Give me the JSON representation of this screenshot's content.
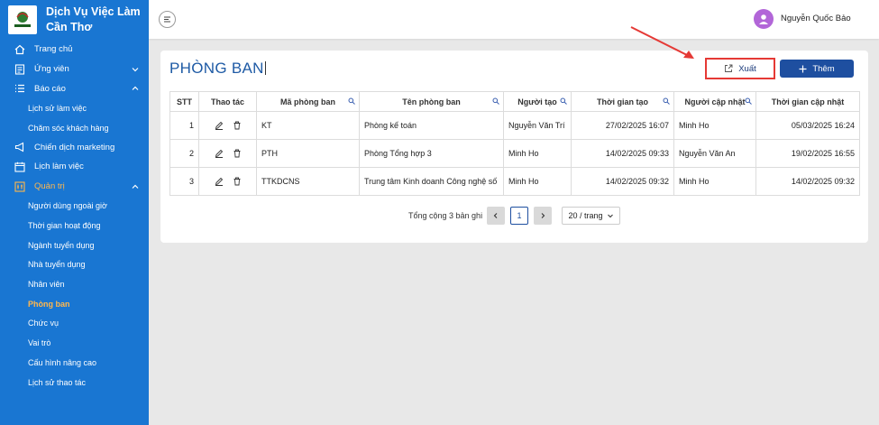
{
  "app": {
    "title": "Dịch Vụ Việc Làm Cần Thơ"
  },
  "sidebar": {
    "items": [
      {
        "label": "Trang chủ",
        "icon": "home-icon"
      },
      {
        "label": "Ứng viên",
        "icon": "candidate-icon"
      },
      {
        "label": "Báo cáo",
        "icon": "list-icon"
      },
      {
        "label": "Lịch sử làm việc"
      },
      {
        "label": "Chăm sóc khách hàng"
      },
      {
        "label": "Chiến dịch marketing",
        "icon": "megaphone-icon"
      },
      {
        "label": "Lịch làm việc",
        "icon": "calendar-icon"
      },
      {
        "label": "Quản trị",
        "icon": "admin-icon"
      },
      {
        "label": "Người dùng ngoài giờ"
      },
      {
        "label": "Thời gian hoạt động"
      },
      {
        "label": "Ngành tuyển dụng"
      },
      {
        "label": "Nhà tuyển dụng"
      },
      {
        "label": "Nhân viên"
      },
      {
        "label": "Phòng ban"
      },
      {
        "label": "Chức vụ"
      },
      {
        "label": "Vai trò"
      },
      {
        "label": "Cấu hình nâng cao"
      },
      {
        "label": "Lịch sử thao tác"
      }
    ]
  },
  "header": {
    "user_name": "Nguyễn Quốc Bảo"
  },
  "main": {
    "title": "PHÒNG BAN",
    "export_label": "Xuất",
    "add_label": "Thêm",
    "columns": [
      "STT",
      "Thao tác",
      "Mã phòng ban",
      "Tên phòng ban",
      "Người tạo",
      "Thời gian tạo",
      "Người cập nhật",
      "Thời gian cập nhật"
    ],
    "rows": [
      {
        "stt": "1",
        "code": "KT",
        "name": "Phòng kế toán",
        "creator": "Nguyễn Văn Trí",
        "created": "27/02/2025 16:07",
        "updater": "Minh Ho",
        "updated": "05/03/2025 16:24"
      },
      {
        "stt": "2",
        "code": "PTH",
        "name": "Phòng Tổng hợp 3",
        "creator": "Minh Ho",
        "created": "14/02/2025 09:33",
        "updater": "Nguyễn Văn An",
        "updated": "19/02/2025 16:55"
      },
      {
        "stt": "3",
        "code": "TTKDCNS",
        "name": "Trung tâm Kinh doanh Công nghệ số",
        "creator": "Minh Ho",
        "created": "14/02/2025 09:32",
        "updater": "Minh Ho",
        "updated": "14/02/2025 09:32"
      }
    ],
    "pagination": {
      "total": "Tổng cộng 3 bản ghi",
      "page": "1",
      "page_size": "20 / trang"
    }
  },
  "colors": {
    "sidebar": "#1976d2",
    "accent": "#1e4fa0",
    "highlight": "#ffb74d",
    "annotation": "#e53935"
  }
}
